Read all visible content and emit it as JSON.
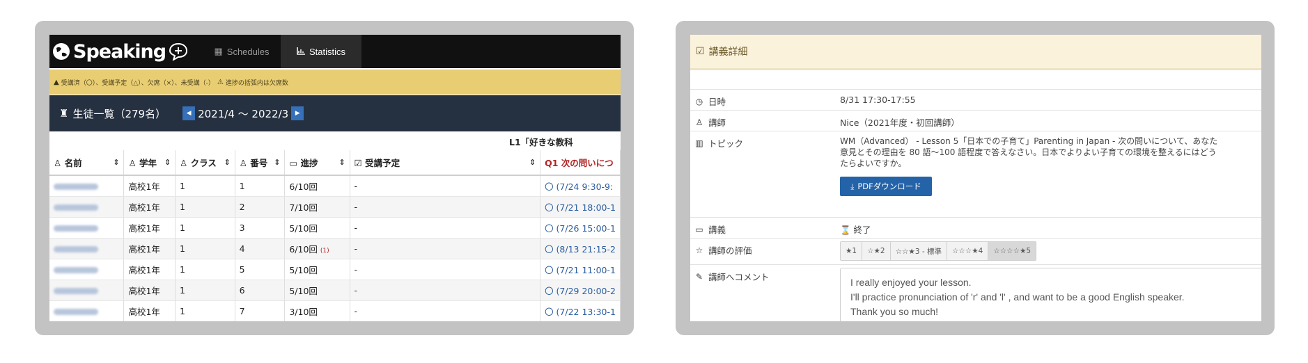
{
  "left_panel": {
    "nav": {
      "logo_text": "Speaking",
      "tabs": [
        {
          "label": "Schedules",
          "icon": "calendar-icon"
        },
        {
          "label": "Statistics",
          "icon": "chart-icon",
          "active": true
        }
      ]
    },
    "legend": {
      "text1": "受講済（〇）、受講予定（△）、欠席（×）、未受講（-）",
      "text2": "進捗の括弧内は欠席数"
    },
    "students": {
      "title": "生徒一覧（279名）",
      "period": "2021/4 〜 2022/3"
    },
    "table": {
      "columns": [
        "名前",
        "学年",
        "クラス",
        "番号",
        "進捗",
        "受講予定"
      ],
      "lesson_column_title": "L1「好きな教科",
      "lesson_column_q": "Q1 次の問いにつ",
      "rows": [
        {
          "grade": "高校1年",
          "class": "1",
          "number": "1",
          "progress": "6/10回",
          "absent": "",
          "planned": "-",
          "schedule": "〇 (7/24 9:30-9:"
        },
        {
          "grade": "高校1年",
          "class": "1",
          "number": "2",
          "progress": "7/10回",
          "absent": "",
          "planned": "-",
          "schedule": "〇 (7/21 18:00-1"
        },
        {
          "grade": "高校1年",
          "class": "1",
          "number": "3",
          "progress": "5/10回",
          "absent": "",
          "planned": "-",
          "schedule": "〇 (7/26 15:00-1"
        },
        {
          "grade": "高校1年",
          "class": "1",
          "number": "4",
          "progress": "6/10回",
          "absent": "(1)",
          "planned": "-",
          "schedule": "〇 (8/13 21:15-2"
        },
        {
          "grade": "高校1年",
          "class": "1",
          "number": "5",
          "progress": "5/10回",
          "absent": "",
          "planned": "-",
          "schedule": "〇 (7/21 11:00-1"
        },
        {
          "grade": "高校1年",
          "class": "1",
          "number": "6",
          "progress": "5/10回",
          "absent": "",
          "planned": "-",
          "schedule": "〇 (7/29 20:00-2"
        },
        {
          "grade": "高校1年",
          "class": "1",
          "number": "7",
          "progress": "3/10回",
          "absent": "",
          "planned": "-",
          "schedule": "〇 (7/22 13:30-1"
        }
      ]
    }
  },
  "right_panel": {
    "header": "講義詳細",
    "datetime": {
      "label": "日時",
      "value": "8/31 17:30-17:55"
    },
    "teacher": {
      "label": "講師",
      "value": "Nice（2021年度・初回講師）"
    },
    "topic": {
      "label": "トピック",
      "line1": "WM（Advanced） - Lesson 5「日本での子育て」Parenting in Japan - 次の問いについて、あなた",
      "line2": "意見とその理由を 80 語〜100 語程度で答えなさい。日本でよりよい子育ての環境を整えるにはどう",
      "line3": "たらよいですか。",
      "pdf_button": "PDFダウンロード"
    },
    "lecture": {
      "label": "講義",
      "value": "終了"
    },
    "rating": {
      "label": "講師の評価",
      "options": [
        "★1",
        "☆★2",
        "☆☆★3 - 標準",
        "☆☆☆★4",
        "☆☆☆☆★5"
      ],
      "selected": 5
    },
    "comment": {
      "label": "講師へコメント",
      "line1": "I really enjoyed your lesson.",
      "line2": "I'll practice pronunciation of 'r' and 'l' , and want to be a good English speaker.",
      "line3": "Thank you so much!"
    }
  }
}
